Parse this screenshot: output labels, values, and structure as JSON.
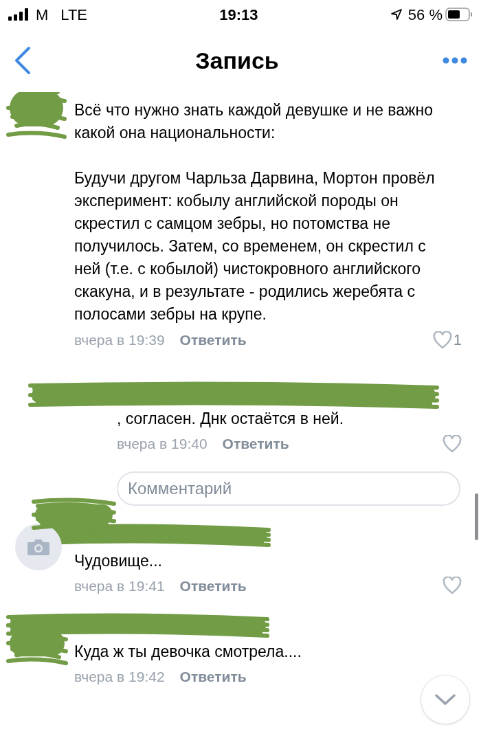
{
  "status_bar": {
    "carrier": "M",
    "network": "LTE",
    "time": "19:13",
    "battery": "56 %"
  },
  "nav": {
    "title": "Запись"
  },
  "comments": [
    {
      "kind": "comment",
      "avatar": {
        "kind": "scribbled"
      },
      "paragraphs": [
        "Всё что нужно знать каждой девушке и не важно какой она национальности:",
        "Будучи другом Чарльза Дарвина, Мортон провёл эксперимент: кобылу английской породы он скрестил с самцом зебры, но потомства не получилось. Затем, со временем, он скрестил с ней (т.е. с кобылой) чистокровного английского скакуна, и в результате - родились жеребята с полосами зебры на крупе."
      ],
      "time": "вчера в 19:39",
      "reply": "Ответить",
      "liked": false,
      "likes": "1"
    },
    {
      "kind": "reply",
      "avatar": {
        "kind": "scribbled"
      },
      "paragraphs": [
        ", согласен. Днк остаётся в ней."
      ],
      "time": "вчера в 19:40",
      "reply": "Ответить",
      "liked": false
    },
    {
      "kind": "input",
      "placeholder": "Комментарий"
    },
    {
      "kind": "comment",
      "avatar": {
        "kind": "camera"
      },
      "paragraphs": [
        "Чудовище..."
      ],
      "time": "вчера в 19:41",
      "reply": "Ответить",
      "liked": false
    },
    {
      "kind": "comment",
      "avatar": {
        "kind": "scribbled"
      },
      "paragraphs": [
        "Куда ж ты девочка смотрела...."
      ],
      "time": "вчера в 19:42",
      "reply": "Ответить"
    }
  ]
}
